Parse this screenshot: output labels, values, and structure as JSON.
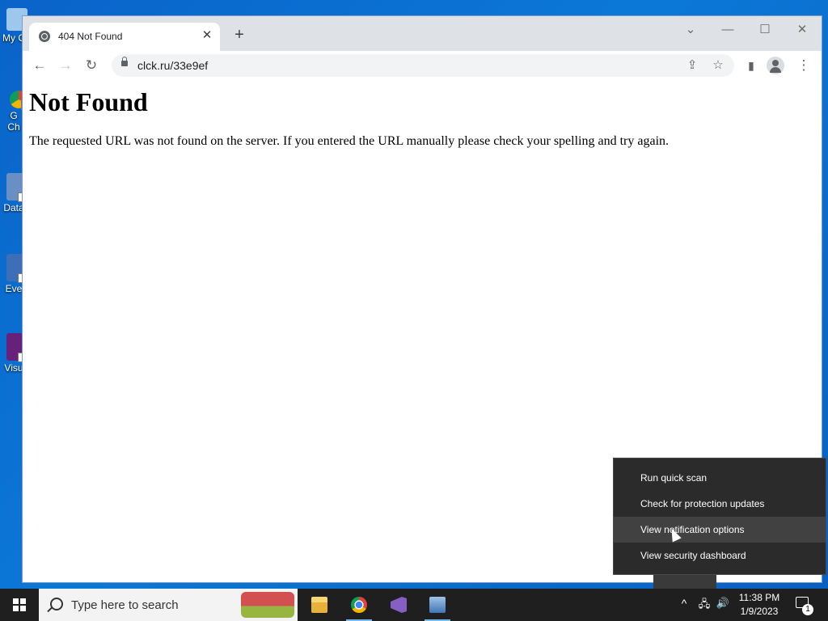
{
  "desktop": {
    "icons": [
      {
        "label": "My C",
        "icon": "computer-icon"
      },
      {
        "label": "G\nCh",
        "icon": "chrome-shortcut-icon"
      },
      {
        "label": "Data",
        "icon": "app-shortcut-icon"
      },
      {
        "label": "Eve",
        "icon": "app-shortcut-icon"
      },
      {
        "label": "Visu",
        "icon": "visual-studio-shortcut-icon"
      }
    ]
  },
  "browser": {
    "tab": {
      "title": "404 Not Found",
      "favicon": "globe-icon",
      "close": "✕"
    },
    "newtab": "+",
    "window_controls": {
      "chevron": "⌄",
      "minimize": "—",
      "maximize": "☐",
      "close": "✕"
    },
    "nav": {
      "back": "←",
      "forward": "→",
      "reload": "↻"
    },
    "url": "clck.ru/33e9ef",
    "omnibox_buttons": {
      "share": "⇪",
      "bookmark": "☆"
    },
    "side_panel": "▮",
    "menu": "⋮"
  },
  "page": {
    "heading": "Not Found",
    "message": "The requested URL was not found on the server. If you entered the URL manually please check your spelling and try again."
  },
  "context_menu": {
    "items": [
      "Run quick scan",
      "Check for protection updates",
      "View notification options",
      "View security dashboard"
    ],
    "hovered_index": 2
  },
  "taskbar": {
    "search_placeholder": "Type here to search",
    "apps": [
      "file-explorer-icon",
      "chrome-icon",
      "visual-studio-icon",
      "network-app-icon"
    ],
    "tray": {
      "chevron": "^",
      "network": "🖧",
      "volume": "🔊"
    },
    "time": "11:38 PM",
    "date": "1/9/2023",
    "notifications_count": "1"
  },
  "colors": {
    "taskbar": "#1f1f1f",
    "menu_bg": "#2b2b2b",
    "menu_hover": "#414141",
    "desktop": "#0b6fd0"
  }
}
